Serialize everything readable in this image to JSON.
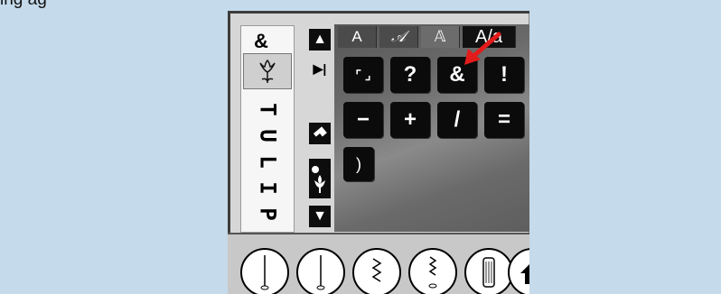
{
  "top_text": "ing ag",
  "left_panel": {
    "top_glyph": "&",
    "thumbnail_icon": "tulip-flower-icon",
    "vertical_letters": [
      "T",
      "U",
      "L",
      "I",
      "P"
    ]
  },
  "tools": [
    {
      "icon": "up-arrow-icon",
      "glyph": "▲"
    },
    {
      "icon": "next-arrow-icon",
      "glyph": "▶|"
    },
    {
      "icon": "eraser-icon",
      "glyph": ""
    },
    {
      "icon": "tulip-stitch-icon",
      "glyph": ""
    },
    {
      "icon": "down-arrow-icon",
      "glyph": "▼"
    }
  ],
  "font_tabs": [
    "A",
    "𝒜",
    "𝔸",
    "A/a"
  ],
  "keys": {
    "row1": [
      "⌜ ⌟",
      "?",
      "&",
      "!"
    ],
    "row2": [
      "−",
      "+",
      "/",
      "="
    ],
    "row3": [
      ")"
    ]
  },
  "bottom_stitches": [
    "straight-stitch-icon",
    "straight-stitch-alt-icon",
    "zigzag-stitch-icon",
    "triple-zigzag-icon",
    "buttonhole-icon",
    "home-icon"
  ],
  "annotation": {
    "color": "#e41b1b"
  }
}
